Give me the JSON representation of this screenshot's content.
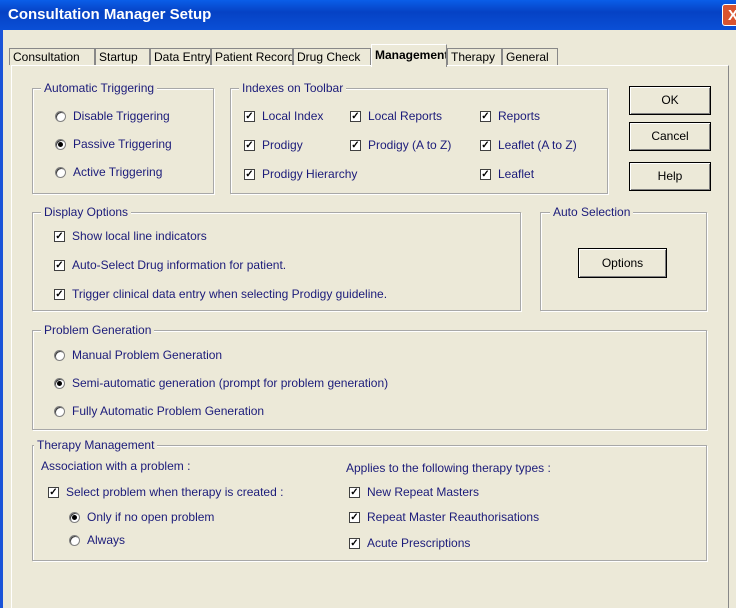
{
  "window": {
    "title": "Consultation Manager Setup",
    "close_glyph": "X"
  },
  "tabs": [
    {
      "label": "Consultation"
    },
    {
      "label": "Startup"
    },
    {
      "label": "Data Entry"
    },
    {
      "label": "Patient Record"
    },
    {
      "label": "Drug Check"
    },
    {
      "label": "Management"
    },
    {
      "label": "Therapy"
    },
    {
      "label": "General"
    }
  ],
  "active_tab": "Management",
  "triggering": {
    "title": "Automatic Triggering",
    "options": [
      {
        "label": "Disable Triggering",
        "selected": false
      },
      {
        "label": "Passive Triggering",
        "selected": true
      },
      {
        "label": "Active Triggering",
        "selected": false
      }
    ]
  },
  "indexes": {
    "title": "Indexes on Toolbar",
    "items": [
      {
        "label": "Local Index",
        "checked": true
      },
      {
        "label": "Local Reports",
        "checked": true
      },
      {
        "label": "Reports",
        "checked": true
      },
      {
        "label": "Prodigy",
        "checked": true
      },
      {
        "label": "Prodigy (A to Z)",
        "checked": true
      },
      {
        "label": "Leaflet (A to Z)",
        "checked": true
      },
      {
        "label": "Prodigy Hierarchy",
        "checked": true
      },
      {
        "label": "Leaflet",
        "checked": true
      }
    ]
  },
  "buttons": {
    "ok": "OK",
    "cancel": "Cancel",
    "help": "Help",
    "options": "Options"
  },
  "display": {
    "title": "Display Options",
    "items": [
      {
        "label": "Show local line indicators",
        "checked": true
      },
      {
        "label": "Auto-Select Drug information for patient.",
        "checked": true
      },
      {
        "label": "Trigger clinical data entry when selecting Prodigy guideline.",
        "checked": true
      }
    ]
  },
  "auto_selection": {
    "title": "Auto Selection"
  },
  "problem": {
    "title": "Problem Generation",
    "options": [
      {
        "label": "Manual Problem Generation",
        "selected": false
      },
      {
        "label": "Semi-automatic generation (prompt for problem generation)",
        "selected": true
      },
      {
        "label": "Fully Automatic Problem Generation",
        "selected": false
      }
    ]
  },
  "therapy": {
    "title": "Therapy Management",
    "assoc_label": "Association with a problem :",
    "select_problem": {
      "label": "Select problem when therapy is created :",
      "checked": true
    },
    "sub_options": [
      {
        "label": "Only if no open problem",
        "selected": true
      },
      {
        "label": "Always",
        "selected": false
      }
    ],
    "applies_label": "Applies to the following therapy types :",
    "types": [
      {
        "label": "New Repeat Masters",
        "checked": true
      },
      {
        "label": "Repeat Master Reauthorisations",
        "checked": true
      },
      {
        "label": "Acute Prescriptions",
        "checked": true
      }
    ]
  },
  "glyphs": {
    "check_mark": "✓"
  }
}
